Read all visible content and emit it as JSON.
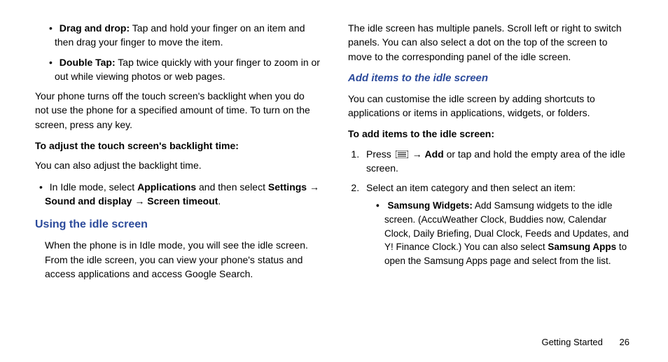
{
  "col1": {
    "bullet1_bold": "Drag and drop:",
    "bullet1_text": " Tap and hold your finger on an item and then drag your finger to move the item.",
    "bullet2_bold": "Double Tap:",
    "bullet2_text": " Tap twice quickly with your finger to zoom in or out while viewing photos or web pages.",
    "para1": "Your phone turns off the touch screen's backlight when you do not use the phone for a specified amount of time. To turn on the screen, press any key.",
    "bold_heading1": "To adjust the touch screen's backlight time:",
    "para2": "You can also adjust the backlight time.",
    "bullet3_prefix": "In Idle mode, select ",
    "bullet3_b1": "Applications",
    "bullet3_mid1": " and then select ",
    "bullet3_b2": "Settings",
    "bullet3_arrow1": " → ",
    "bullet3_b3": "Sound and display",
    "bullet3_arrow2": " → ",
    "bullet3_b4": "Screen timeout",
    "bullet3_end": ".",
    "h2": "Using the idle screen",
    "para3": "When the phone is in Idle mode, you will see the idle screen. From the idle screen, you can view your phone's status and access applications and access Google Search."
  },
  "col2": {
    "para1": "The idle screen has multiple panels. Scroll left or right to switch panels. You can also select a dot on the top of the screen to move to the corresponding panel of the idle screen.",
    "h3": "Add items to the idle screen",
    "para2": "You can customise the idle screen by adding shortcuts to applications or items in applications, widgets, or folders.",
    "bold_heading1": "To add items to the idle screen:",
    "step1_prefix": "Press ",
    "step1_arrow": " → ",
    "step1_b1": "Add",
    "step1_suffix": " or tap and hold the empty area of the idle screen.",
    "step2": "Select an item category and then select an item:",
    "sub1_bold": "Samsung Widgets:",
    "sub1_text1": " Add Samsung widgets to the idle screen. (AccuWeather Clock, Buddies now, Calendar Clock, Daily Briefing, Dual Clock, Feeds and Updates, and Y! Finance Clock.) You can also select ",
    "sub1_b2": "Samsung Apps",
    "sub1_text2": " to open the Samsung Apps page and select from the list."
  },
  "footer": {
    "section": "Getting Started",
    "page": "26"
  }
}
